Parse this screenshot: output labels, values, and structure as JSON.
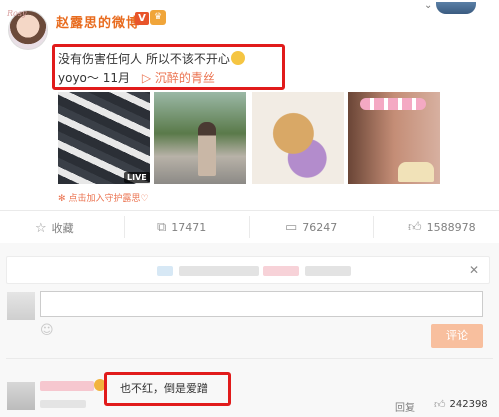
{
  "header": {
    "avatar_tag": "Rosy",
    "name": "赵露思的微博",
    "verified_badge": "V",
    "member_badge": "♛"
  },
  "post": {
    "text": "没有伤害任何人 所以不该不开心",
    "music_artist": "yoyo～ 11月",
    "music_play_icon": "▷",
    "music_title": "沉醉的青丝",
    "live_badge": "LIVE",
    "guard_link": "点击加入守护露思♡"
  },
  "actions": {
    "favorite": {
      "icon": "star-icon",
      "label": "收藏"
    },
    "repost": {
      "icon": "repost-icon",
      "count": "17471"
    },
    "comment": {
      "icon": "comment-icon",
      "count": "76247"
    },
    "like": {
      "icon": "thumb-up-icon",
      "count": "1588978"
    }
  },
  "comment_box": {
    "placeholder": "",
    "submit_label": "评论",
    "notice_close": "✕"
  },
  "comments": [
    {
      "text": "也不红，倒是爱蹭",
      "reply_label": "回复",
      "like_count": "242398"
    }
  ],
  "colors": {
    "accent": "#eb7350",
    "name_orange": "#e86b1e",
    "highlight_red": "#e11b1b",
    "submit_bg": "#f8bf9e"
  }
}
